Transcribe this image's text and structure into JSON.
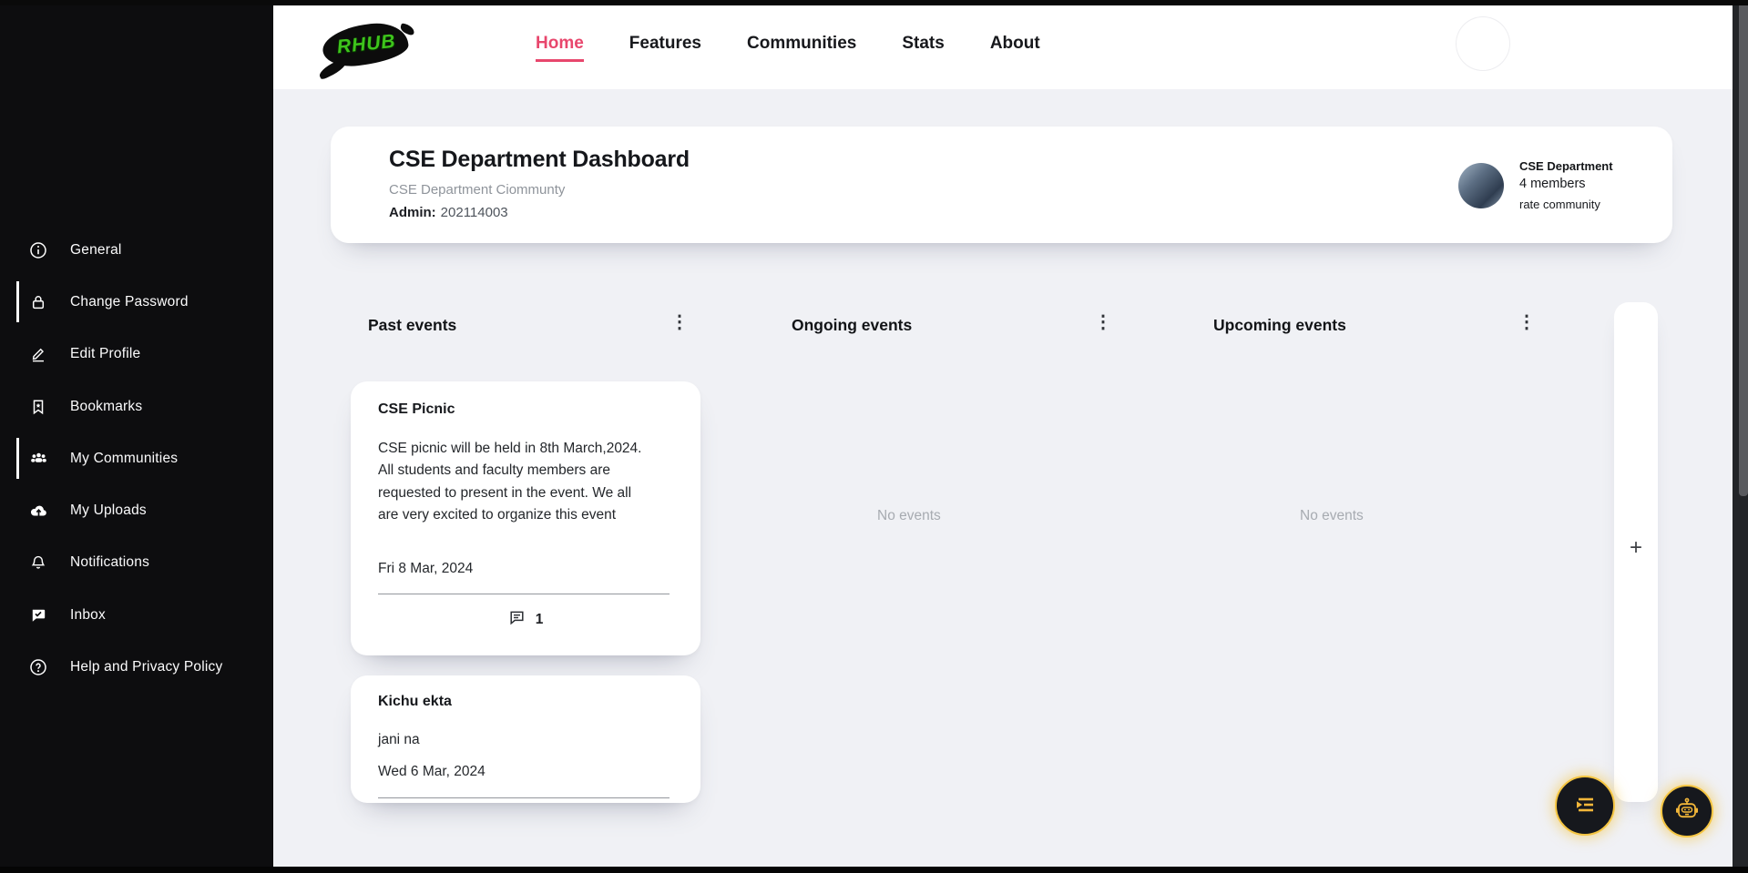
{
  "navbar": {
    "logo_text": "RHUB",
    "links": [
      {
        "label": "Home",
        "active": true
      },
      {
        "label": "Features",
        "active": false
      },
      {
        "label": "Communities",
        "active": false
      },
      {
        "label": "Stats",
        "active": false
      },
      {
        "label": "About",
        "active": false
      }
    ]
  },
  "sidebar": {
    "items": [
      {
        "label": "General",
        "icon": "info-icon",
        "active": false
      },
      {
        "label": "Change Password",
        "icon": "lock-icon",
        "active": true
      },
      {
        "label": "Edit Profile",
        "icon": "edit-icon",
        "active": false
      },
      {
        "label": "Bookmarks",
        "icon": "bookmark-icon",
        "active": false
      },
      {
        "label": "My Communities",
        "icon": "communities-icon",
        "active": true
      },
      {
        "label": "My Uploads",
        "icon": "upload-icon",
        "active": false
      },
      {
        "label": "Notifications",
        "icon": "bell-icon",
        "active": false
      },
      {
        "label": "Inbox",
        "icon": "inbox-icon",
        "active": false
      },
      {
        "label": "Help and Privacy Policy",
        "icon": "help-icon",
        "active": false
      }
    ]
  },
  "dashboard": {
    "title": "CSE Department Dashboard",
    "subtitle": "CSE Department Ciommunty",
    "admin_label": "Admin:",
    "admin_id": "202114003",
    "community": {
      "name": "CSE Department",
      "members": "4 members",
      "rate_label": "rate community"
    }
  },
  "columns": {
    "past": {
      "title": "Past events"
    },
    "ongoing": {
      "title": "Ongoing events",
      "empty": "No events"
    },
    "upcoming": {
      "title": "Upcoming events",
      "empty": "No events"
    }
  },
  "events": [
    {
      "title": "CSE Picnic",
      "description": "CSE picnic will be held in 8th March,2024. All students and faculty members are requested to present in the event. We all are very excited to organize this event",
      "date": "Fri 8 Mar, 2024",
      "comment_count": "1"
    },
    {
      "title": "Kichu ekta",
      "description": "jani na",
      "date": "Wed 6 Mar, 2024"
    }
  ],
  "side_panel": {
    "add_label": "+"
  },
  "icons": {
    "kebab_glyph": "⋮"
  },
  "colors": {
    "accent_pink": "#e8476d",
    "gold": "#f5c542",
    "logo_green": "#3ec41c",
    "sidebar_bg": "#0d0d0f",
    "page_bg": "#f0f1f5"
  }
}
